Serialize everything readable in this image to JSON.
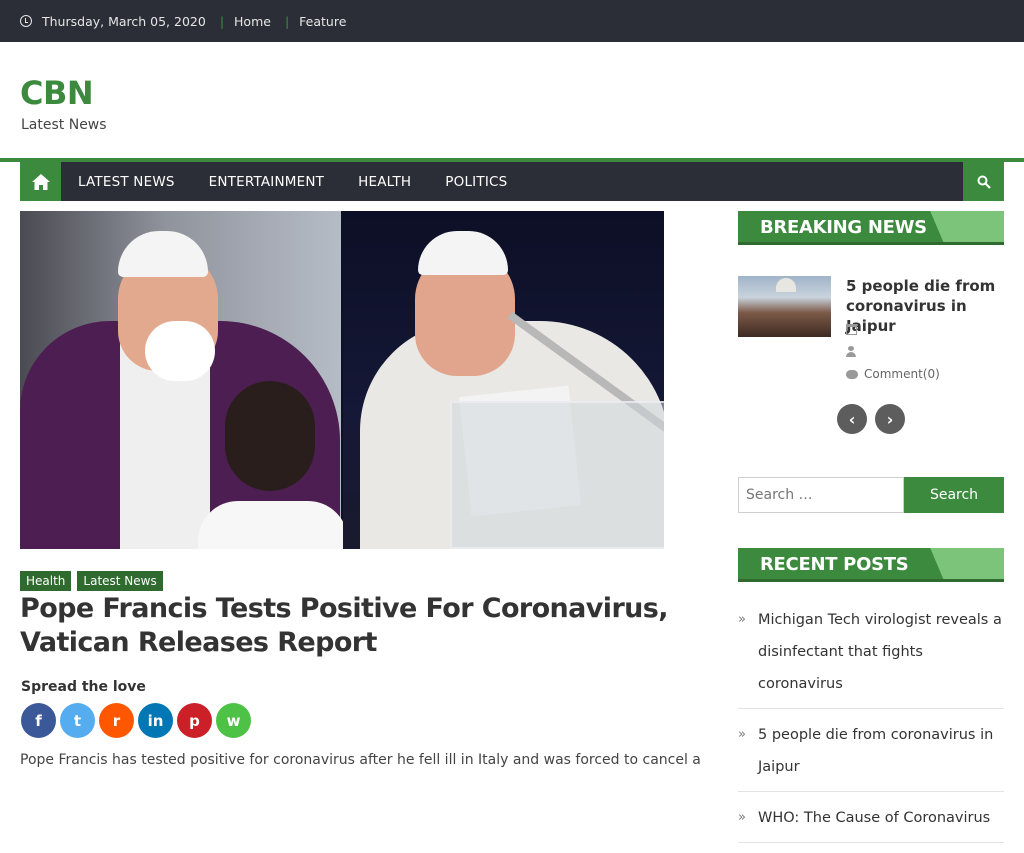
{
  "topbar": {
    "date": "Thursday, March 05, 2020",
    "links": [
      "Home",
      "Feature"
    ]
  },
  "site": {
    "title": "CBN",
    "description": "Latest News"
  },
  "nav": {
    "items": [
      "LATEST NEWS",
      "ENTERTAINMENT",
      "HEALTH",
      "POLITICS"
    ]
  },
  "post": {
    "categories": [
      "Health",
      "Latest News"
    ],
    "title": "Pope Francis Tests Positive For Coronavirus, Vatican Releases Report",
    "spread_label": "Spread the love",
    "share_buttons": [
      {
        "name": "facebook",
        "glyph": "f",
        "color": "#3b5998"
      },
      {
        "name": "twitter",
        "glyph": "t",
        "color": "#55acee"
      },
      {
        "name": "reddit",
        "glyph": "r",
        "color": "#ff5700"
      },
      {
        "name": "linkedin",
        "glyph": "in",
        "color": "#0077b5"
      },
      {
        "name": "pinterest",
        "glyph": "p",
        "color": "#cb2027"
      },
      {
        "name": "whatsapp",
        "glyph": "w",
        "color": "#4dc247"
      }
    ],
    "excerpt": "Pope Francis has tested positive for coronavirus after he fell ill in Italy and was forced to cancel a"
  },
  "sidebar": {
    "breaking": {
      "heading": "BREAKING NEWS",
      "item_title": "5 people die from coronavirus in Jaipur",
      "comment": "Comment(0)",
      "prev": "‹",
      "next": "›"
    },
    "search": {
      "placeholder": "Search …",
      "button": "Search"
    },
    "recent": {
      "heading": "RECENT POSTS",
      "items": [
        "Michigan Tech virologist reveals a disinfectant that fights coronavirus",
        "5 people die from coronavirus in Jaipur",
        "WHO: The Cause of Coronavirus"
      ]
    }
  },
  "colors": {
    "accent": "#3b8a3e",
    "dark_bar": "#2b2e36"
  }
}
